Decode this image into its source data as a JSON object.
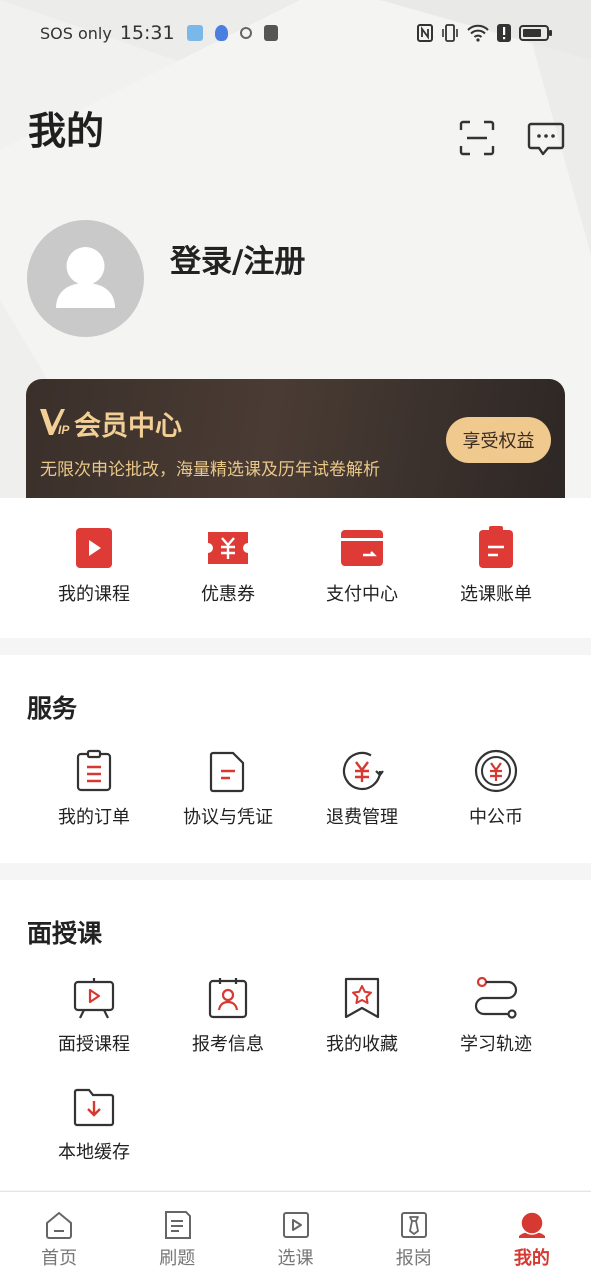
{
  "status_bar": {
    "carrier": "SOS only",
    "time": "15:31"
  },
  "header": {
    "title": "我的",
    "icons": [
      "scan-icon",
      "message-icon"
    ]
  },
  "profile": {
    "login_label": "登录/注册"
  },
  "vip": {
    "title": "会员中心",
    "description": "无限次申论批改，海量精选课及历年试卷解析",
    "button_label": "享受权益"
  },
  "quick_actions": [
    {
      "label": "我的课程",
      "icon": "play-icon"
    },
    {
      "label": "优惠券",
      "icon": "coupon-icon"
    },
    {
      "label": "支付中心",
      "icon": "wallet-icon"
    },
    {
      "label": "选课账单",
      "icon": "bill-icon"
    }
  ],
  "services": {
    "title": "服务",
    "items": [
      {
        "label": "我的订单",
        "icon": "clipboard-icon"
      },
      {
        "label": "协议与凭证",
        "icon": "document-icon"
      },
      {
        "label": "退费管理",
        "icon": "refund-icon"
      },
      {
        "label": "中公币",
        "icon": "coin-icon"
      }
    ]
  },
  "face_course": {
    "title": "面授课",
    "items": [
      {
        "label": "面授课程",
        "icon": "video-board-icon"
      },
      {
        "label": "报考信息",
        "icon": "profile-card-icon"
      },
      {
        "label": "我的收藏",
        "icon": "bookmark-star-icon"
      },
      {
        "label": "学习轨迹",
        "icon": "route-icon"
      },
      {
        "label": "本地缓存",
        "icon": "download-folder-icon"
      }
    ]
  },
  "bottom_nav": [
    {
      "label": "首页",
      "icon": "home-icon"
    },
    {
      "label": "刷题",
      "icon": "exercise-icon"
    },
    {
      "label": "选课",
      "icon": "play-icon"
    },
    {
      "label": "报岗",
      "icon": "tie-icon"
    },
    {
      "label": "我的",
      "icon": "profile-icon",
      "active": true
    }
  ],
  "colors": {
    "accent_red": "#d63832",
    "vip_gold": "#f2cf95",
    "vip_bg": "#3a2f2a"
  }
}
